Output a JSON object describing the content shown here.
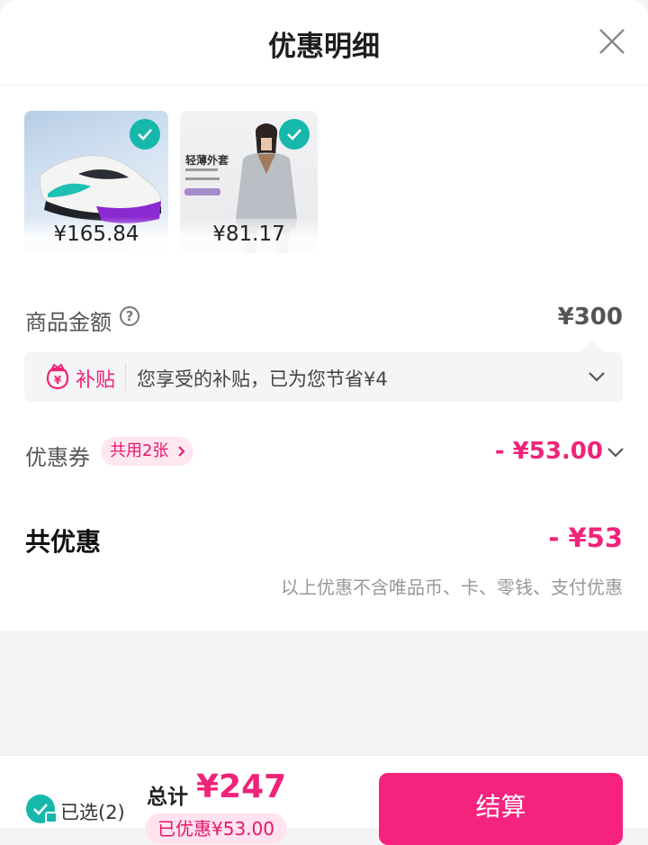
{
  "header": {
    "title": "优惠明细"
  },
  "products": [
    {
      "price": "¥165.84",
      "selected": true
    },
    {
      "price": "¥81.17",
      "selected": true,
      "image_caption": "轻薄外套"
    }
  ],
  "goods_amount": {
    "label": "商品金额",
    "value": "¥300"
  },
  "subsidy": {
    "tag": "补贴",
    "text": "您享受的补贴，已为您节省¥4"
  },
  "coupon": {
    "label": "优惠券",
    "chip": "共用2张",
    "amount": "- ¥53.00"
  },
  "total_discount": {
    "label": "共优惠",
    "amount": "- ¥53",
    "note": "以上优惠不含唯品币、卡、零钱、支付优惠"
  },
  "footer": {
    "selected": "已选(2)",
    "total_label": "总计",
    "total_value": "¥247",
    "saved": "已优惠¥53.00",
    "pay_button": "结算"
  },
  "colors": {
    "accent": "#f0237a",
    "check": "#16b8ab"
  },
  "icons": [
    "close-icon",
    "help-icon",
    "subsidy-icon",
    "chevron-down-icon",
    "chevron-right-icon",
    "check-icon",
    "lock-icon"
  ]
}
